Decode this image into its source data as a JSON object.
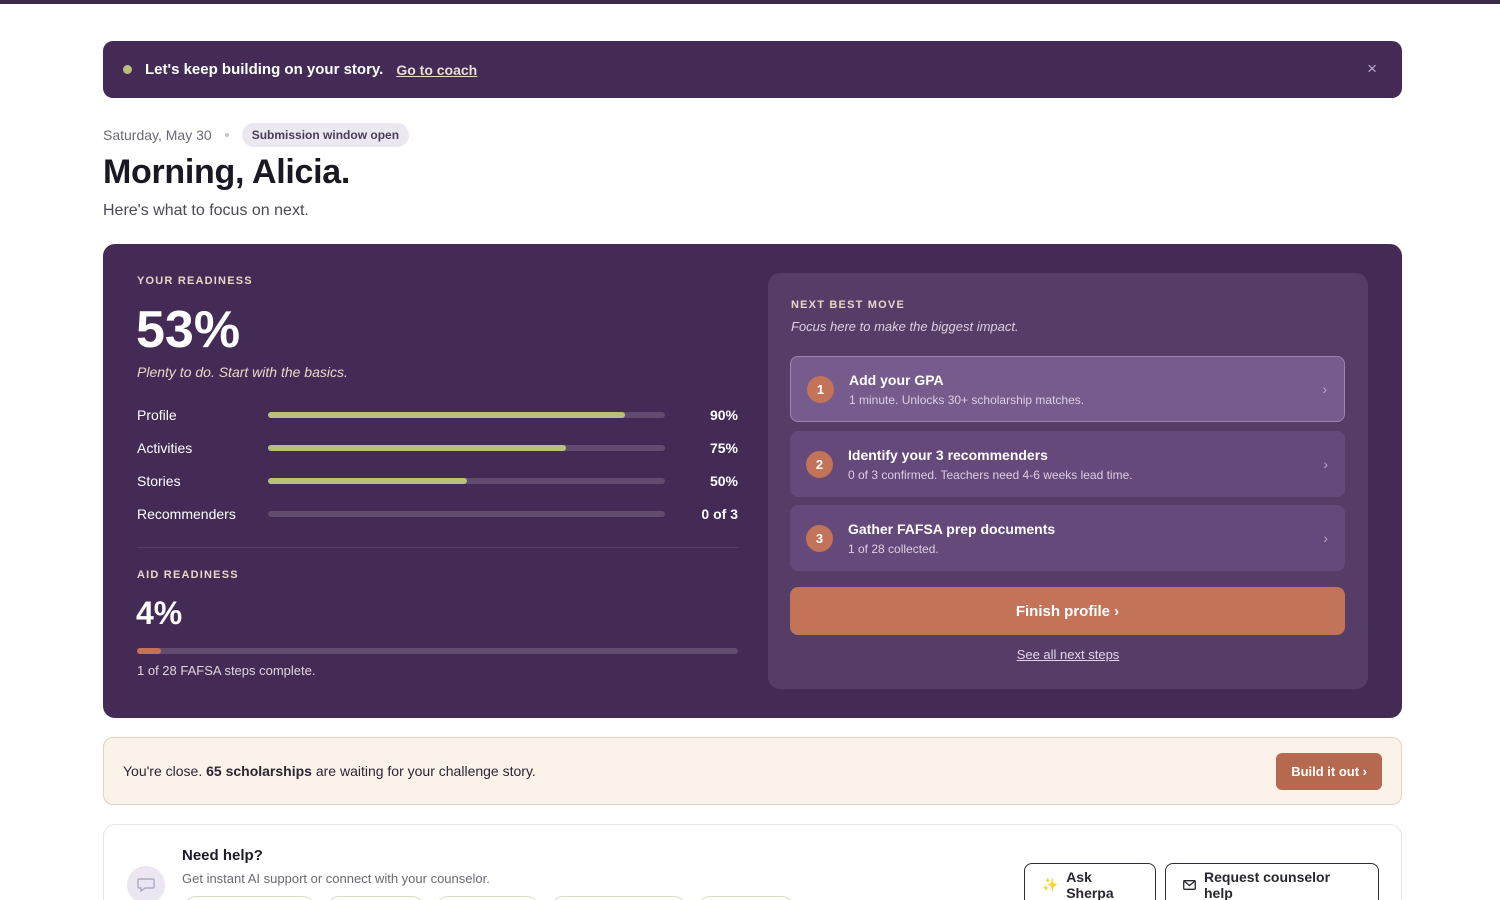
{
  "banner": {
    "message": "Let's keep building on your story.",
    "link": "Go to coach",
    "close_icon": "×"
  },
  "header": {
    "date": "Saturday, May 30",
    "badge": "Submission window open",
    "greeting": "Morning, Alicia.",
    "subtitle": "Here's what to focus on next."
  },
  "readiness": {
    "label": "YOUR READINESS",
    "percent": "53%",
    "note": "Plenty to do. Start with the basics.",
    "items": [
      {
        "name": "Profile",
        "value": "90%",
        "fraction": 0.9
      },
      {
        "name": "Activities",
        "value": "75%",
        "fraction": 0.75
      },
      {
        "name": "Stories",
        "value": "50%",
        "fraction": 0.5
      },
      {
        "name": "Recommenders",
        "value": "0 of 3",
        "fraction": 0.0
      }
    ]
  },
  "aid": {
    "label": "AID READINESS",
    "percent": "4%",
    "fraction": 0.04,
    "note": "1 of 28 FAFSA steps complete."
  },
  "next_move": {
    "label": "NEXT BEST MOVE",
    "subtitle": "Focus here to make the biggest impact.",
    "steps": [
      {
        "num": "1",
        "title": "Add your GPA",
        "desc": "1 minute. Unlocks 30+ scholarship matches."
      },
      {
        "num": "2",
        "title": "Identify your 3 recommenders",
        "desc": "0 of 3 confirmed. Teachers need 4-6 weeks lead time."
      },
      {
        "num": "3",
        "title": "Gather FAFSA prep documents",
        "desc": "1 of 28 collected."
      }
    ],
    "cta": "Finish profile ›",
    "see_all": "See all next steps"
  },
  "scholarship": {
    "prefix": "You're close.",
    "bold": "65 scholarships",
    "suffix": "are waiting for your challenge story.",
    "button": "Build it out ›"
  },
  "help": {
    "title": "Need help?",
    "subtitle": "Get instant AI support or connect with your counselor.",
    "ask_button": "Ask Sherpa",
    "counselor_button": "Request counselor help"
  },
  "colors": {
    "brand_purple": "#432b55",
    "accent_terracotta": "#c27358",
    "progress_green": "#b8c07a"
  }
}
